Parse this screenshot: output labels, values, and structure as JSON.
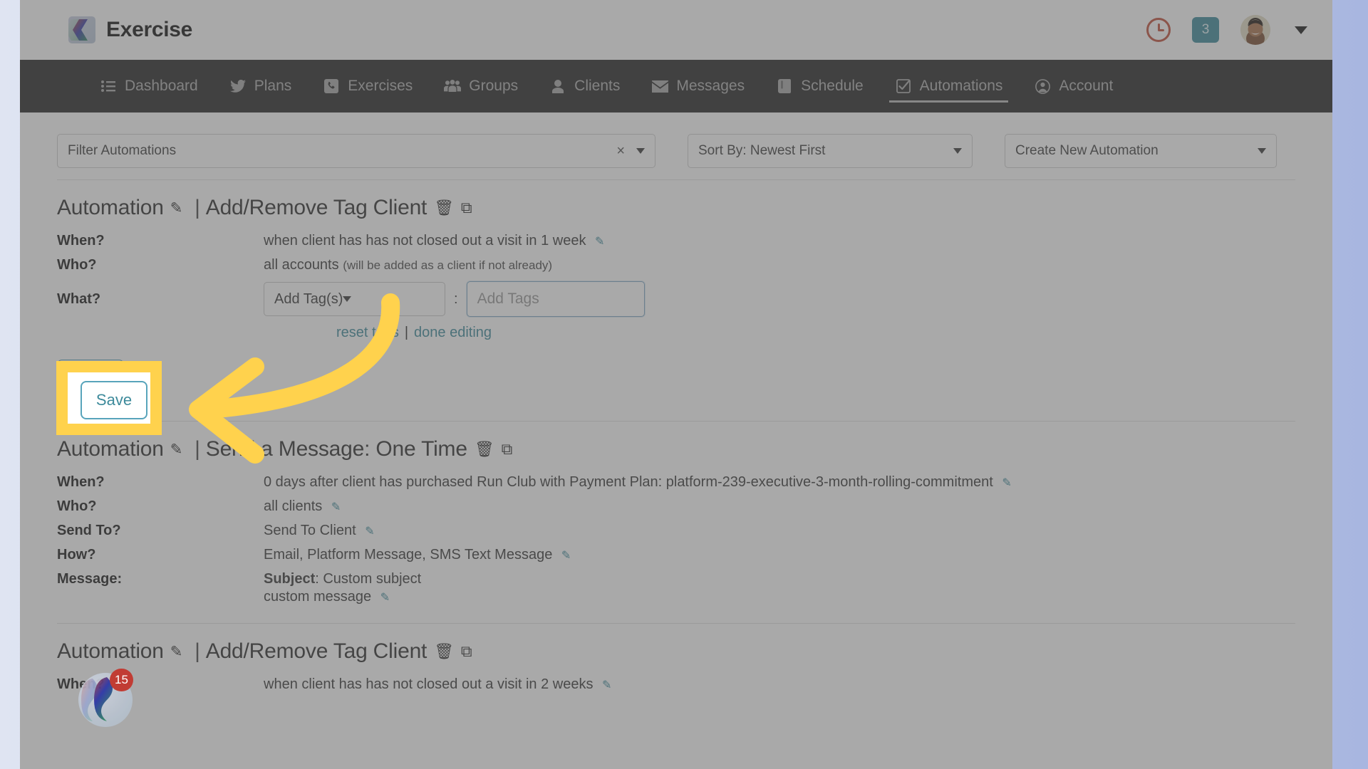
{
  "header": {
    "brand_name": "Exercise",
    "brand_logo_icon": "exercise-wave-logo",
    "clock_icon": "clock-icon",
    "notification_count": "3",
    "avatar_icon": "user-avatar",
    "chevron_icon": "chevron-down-icon"
  },
  "nav": {
    "items": [
      {
        "label": "Dashboard",
        "icon": "list-icon",
        "active": false
      },
      {
        "label": "Plans",
        "icon": "twitter-bird-icon",
        "active": false
      },
      {
        "label": "Exercises",
        "icon": "phone-square-icon",
        "active": false
      },
      {
        "label": "Groups",
        "icon": "users-icon",
        "active": false
      },
      {
        "label": "Clients",
        "icon": "user-icon",
        "active": false
      },
      {
        "label": "Messages",
        "icon": "envelope-icon",
        "active": false
      },
      {
        "label": "Schedule",
        "icon": "book-icon",
        "active": false
      },
      {
        "label": "Automations",
        "icon": "check-square-icon",
        "active": true
      },
      {
        "label": "Account",
        "icon": "user-circle-icon",
        "active": false
      }
    ]
  },
  "toolbar": {
    "filter": {
      "value": "Filter Automations",
      "clear_label": "×",
      "clear_icon": "clear-x-icon",
      "caret_icon": "chevron-down-icon"
    },
    "sort": {
      "value": "Sort By: Newest First",
      "caret_icon": "chevron-down-icon"
    },
    "create": {
      "value": "Create New Automation",
      "caret_icon": "chevron-down-icon"
    }
  },
  "automations": [
    {
      "prefix": "Automation",
      "edit_icon": "pencil-icon",
      "divider": "|",
      "name": "Add/Remove Tag Client",
      "delete_icon": "trash-icon",
      "copy_icon": "duplicate-icon",
      "rows": [
        {
          "key": "When?",
          "value": "when client has has not closed out a visit in 1 week",
          "edit_icon": "pencil-icon"
        },
        {
          "key": "Who?",
          "value": "all accounts",
          "suffix": "(will be added as a client if not already)"
        },
        {
          "key": "What?",
          "is_editor": true
        }
      ],
      "editor": {
        "tag_action_value": "Add Tag(s)",
        "tag_action_caret": "chevron-down-icon",
        "colon": ":",
        "tag_input_placeholder": "Add Tags",
        "tag_input_value": "",
        "reset_link": "reset tags",
        "link_divider": "|",
        "done_link": "done editing"
      },
      "save_label": "Save"
    },
    {
      "prefix": "Automation",
      "edit_icon": "pencil-icon",
      "divider": "|",
      "name": "Send a Message: One Time",
      "delete_icon": "trash-icon",
      "copy_icon": "duplicate-icon",
      "rows": [
        {
          "key": "When?",
          "value": "0 days after client has purchased Run Club with Payment Plan: platform-239-executive-3-month-rolling-commitment",
          "edit_icon": "pencil-icon"
        },
        {
          "key": "Who?",
          "value": "all clients",
          "edit_icon": "pencil-icon"
        },
        {
          "key": "Send To?",
          "value": "Send To Client",
          "edit_icon": "pencil-icon"
        },
        {
          "key": "How?",
          "value": "Email, Platform Message, SMS Text Message",
          "edit_icon": "pencil-icon"
        }
      ],
      "message": {
        "key": "Message:",
        "subject_label": "Subject",
        "subject_value": ": Custom subject",
        "body_value": "custom message",
        "edit_icon": "pencil-icon"
      }
    },
    {
      "prefix": "Automation",
      "edit_icon": "pencil-icon",
      "divider": "|",
      "name": "Add/Remove Tag Client",
      "delete_icon": "trash-icon",
      "copy_icon": "duplicate-icon",
      "rows": [
        {
          "key": "When?",
          "value": "when client has has not closed out a visit in 2 weeks",
          "edit_icon": "pencil-icon"
        }
      ]
    }
  ],
  "annotation": {
    "highlight_target": "save-button",
    "highlight_color": "#ffd24d",
    "arrow_color": "#ffd24d",
    "save_label": "Save"
  },
  "chat_widget": {
    "badge_count": "15",
    "icon": "chat-wave-logo"
  },
  "colors": {
    "nav_bg": "#262626",
    "accent_teal": "#3d8a9b",
    "badge_teal": "#3d8a9b",
    "clock_red": "#c0503c",
    "highlight_yellow": "#ffd24d",
    "chat_badge_red": "#c13c34"
  }
}
